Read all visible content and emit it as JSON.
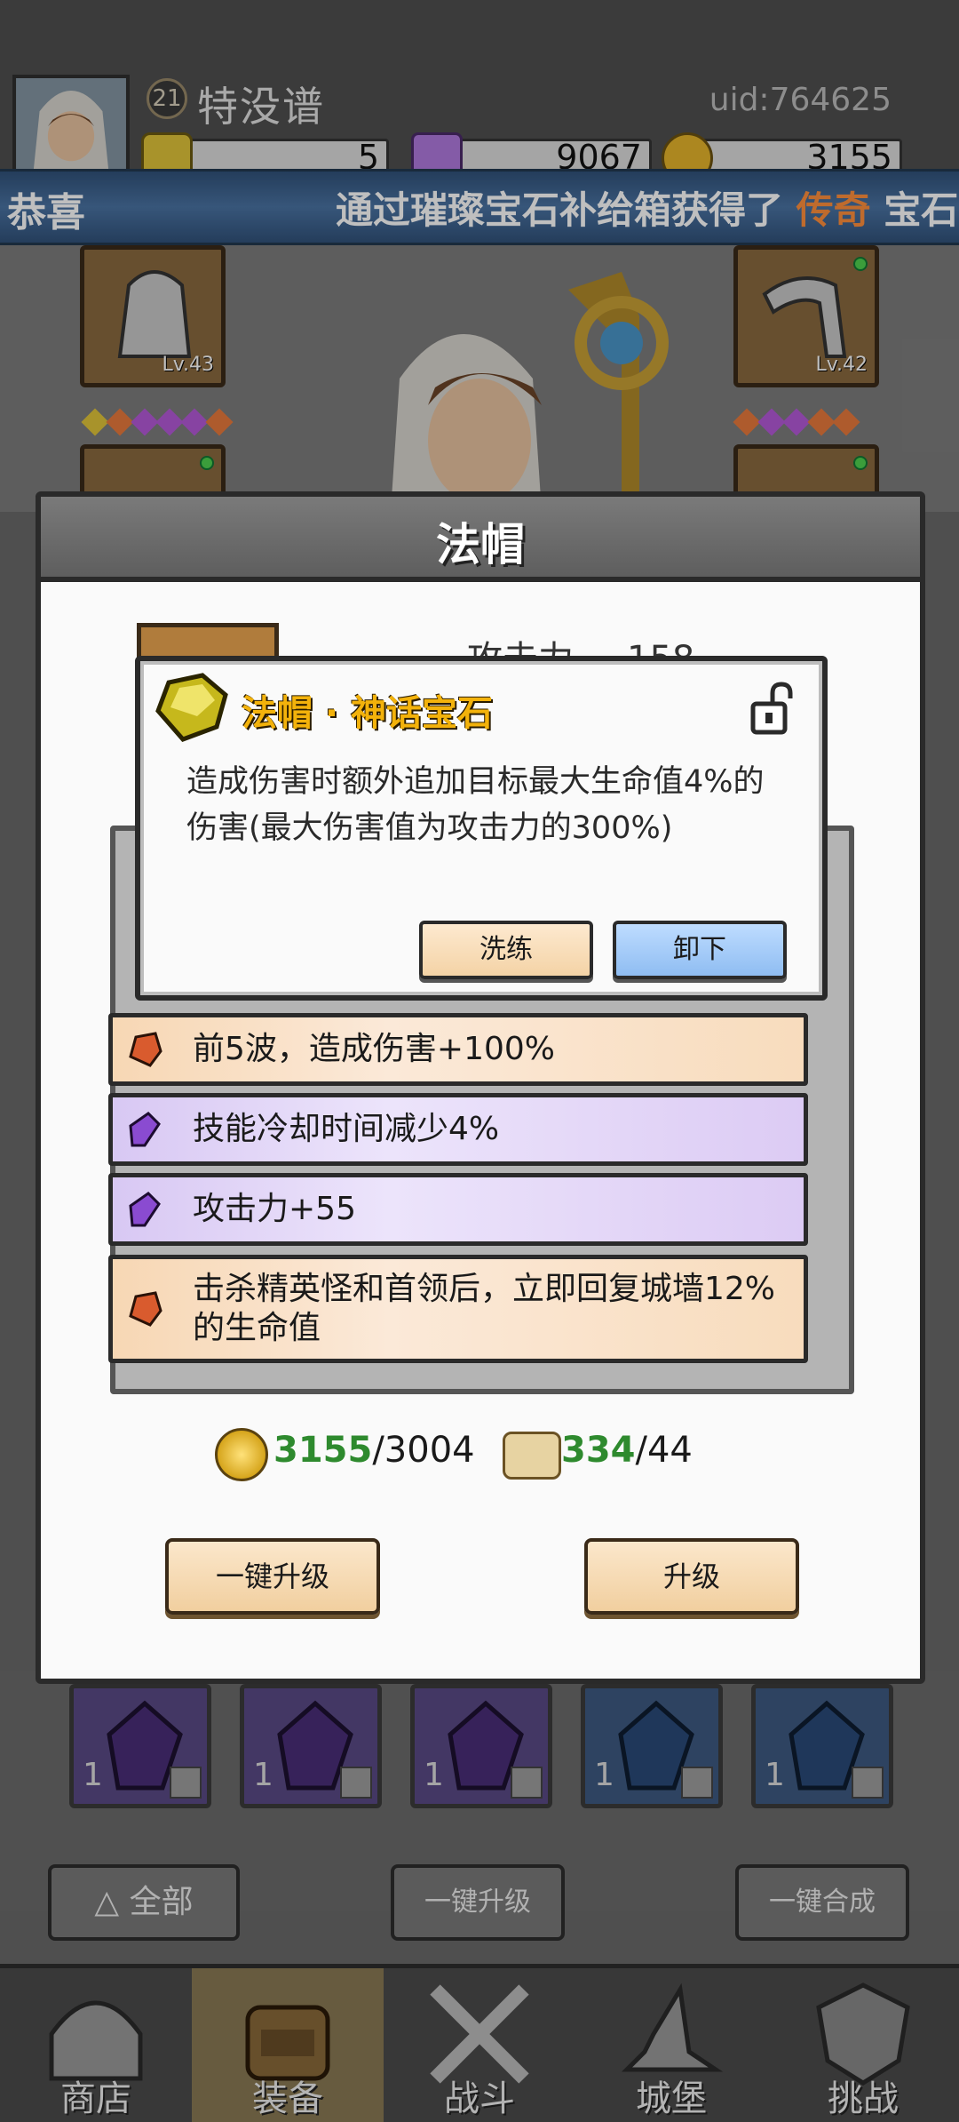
{
  "player": {
    "level": "21",
    "name": "特没谱",
    "uid": "uid:764625"
  },
  "resources": {
    "gold_gem": "5",
    "crystal": "9067",
    "coin": "3155"
  },
  "banner": {
    "prefix": "恭喜",
    "message_before": "通过璀璨宝石补给箱获得了",
    "highlight": "传奇",
    "message_after": "宝石"
  },
  "equipment_slots": {
    "left_level": "Lv.43",
    "right_level": "Lv.42"
  },
  "dialog": {
    "title": "法帽",
    "stat_label": "攻击力",
    "stat_value": "158",
    "affixes": [
      {
        "text": "前5波，造成伤害+100%",
        "quality": "orange"
      },
      {
        "text": "技能冷却时间减少4%",
        "quality": "purple"
      },
      {
        "text": "攻击力+55",
        "quality": "purple"
      },
      {
        "text": "击杀精英怪和首领后，立即回复城墙12%的生命值",
        "quality": "orange"
      }
    ],
    "cost": {
      "coin_have": "3155",
      "coin_need": "/3004",
      "scroll_have": "334",
      "scroll_need": "/44"
    },
    "buttons": {
      "one_click_upgrade": "一键升级",
      "upgrade": "升级"
    }
  },
  "gem_popup": {
    "title": "法帽 · 神话宝石",
    "description": "造成伤害时额外追加目标最大生命值4%的伤害(最大伤害值为攻击力的300%)",
    "buttons": {
      "wash": "洗练",
      "remove": "卸下"
    }
  },
  "inventory": {
    "counts": [
      "1",
      "1",
      "1",
      "1",
      "1"
    ]
  },
  "bottom_buttons": {
    "filter": "全部",
    "one_click_upgrade": "一键升级",
    "one_click_merge": "一键合成"
  },
  "nav": {
    "shop": "商店",
    "equipment": "装备",
    "battle": "战斗",
    "castle": "城堡",
    "challenge": "挑战"
  },
  "colors": {
    "accent_gold": "#f3b20b",
    "banner_blue": "#4a73a3",
    "legendary_orange": "#ff8f3c",
    "positive_green": "#2e8a2e"
  }
}
